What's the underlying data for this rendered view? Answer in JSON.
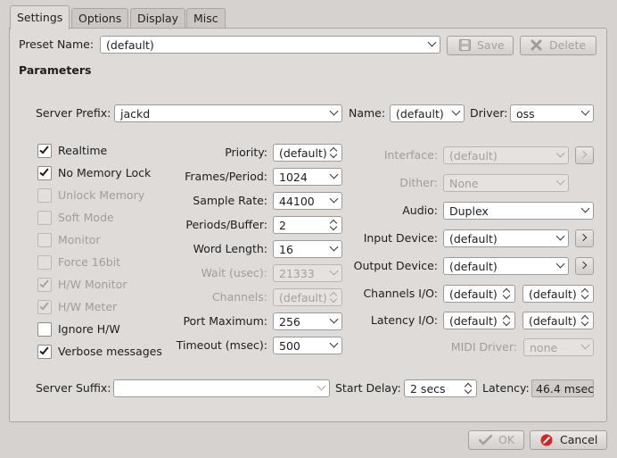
{
  "tabs": [
    "Settings",
    "Options",
    "Display",
    "Misc"
  ],
  "preset": {
    "label": "Preset Name:",
    "value": "(default)",
    "save": "Save",
    "delete": "Delete"
  },
  "parameters_title": "Parameters",
  "server": {
    "prefix_label": "Server Prefix:",
    "prefix_value": "jackd",
    "name_label": "Name:",
    "name_value": "(default)",
    "driver_label": "Driver:",
    "driver_value": "oss"
  },
  "checkboxes": [
    {
      "label": "Realtime",
      "checked": true,
      "enabled": true
    },
    {
      "label": "No Memory Lock",
      "checked": true,
      "enabled": true
    },
    {
      "label": "Unlock Memory",
      "checked": false,
      "enabled": false
    },
    {
      "label": "Soft Mode",
      "checked": false,
      "enabled": false
    },
    {
      "label": "Monitor",
      "checked": false,
      "enabled": false
    },
    {
      "label": "Force 16bit",
      "checked": false,
      "enabled": false
    },
    {
      "label": "H/W Monitor",
      "checked": true,
      "enabled": false
    },
    {
      "label": "H/W Meter",
      "checked": true,
      "enabled": false
    },
    {
      "label": "Ignore H/W",
      "checked": false,
      "enabled": true
    },
    {
      "label": "Verbose messages",
      "checked": true,
      "enabled": true
    }
  ],
  "mid_fields": [
    {
      "label": "Priority:",
      "value": "(default)",
      "control": "spin",
      "enabled": true
    },
    {
      "label": "Frames/Period:",
      "value": "1024",
      "control": "combo",
      "enabled": true
    },
    {
      "label": "Sample Rate:",
      "value": "44100",
      "control": "combo",
      "enabled": true
    },
    {
      "label": "Periods/Buffer:",
      "value": "2",
      "control": "spin",
      "enabled": true
    },
    {
      "label": "Word Length:",
      "value": "16",
      "control": "combo",
      "enabled": true
    },
    {
      "label": "Wait (usec):",
      "value": "21333",
      "control": "combo",
      "enabled": false
    },
    {
      "label": "Channels:",
      "value": "(default)",
      "control": "spin",
      "enabled": false
    },
    {
      "label": "Port Maximum:",
      "value": "256",
      "control": "combo",
      "enabled": true
    },
    {
      "label": "Timeout (msec):",
      "value": "500",
      "control": "combo",
      "enabled": true
    }
  ],
  "right_fields": {
    "interface_label": "Interface:",
    "interface_value": "(default)",
    "dither_label": "Dither:",
    "dither_value": "None",
    "audio_label": "Audio:",
    "audio_value": "Duplex",
    "input_label": "Input Device:",
    "input_value": "(default)",
    "output_label": "Output Device:",
    "output_value": "(default)",
    "chan_io_label": "Channels I/O:",
    "chan_io_in": "(default)",
    "chan_io_out": "(default)",
    "lat_io_label": "Latency I/O:",
    "lat_io_in": "(default)",
    "lat_io_out": "(default)",
    "midi_label": "MIDI Driver:",
    "midi_value": "none"
  },
  "bottom": {
    "suffix_label": "Server Suffix:",
    "suffix_value": "",
    "delay_label": "Start Delay:",
    "delay_value": "2 secs",
    "latency_label": "Latency:",
    "latency_value": "46.4 msec"
  },
  "dialog": {
    "ok": "OK",
    "cancel": "Cancel"
  }
}
